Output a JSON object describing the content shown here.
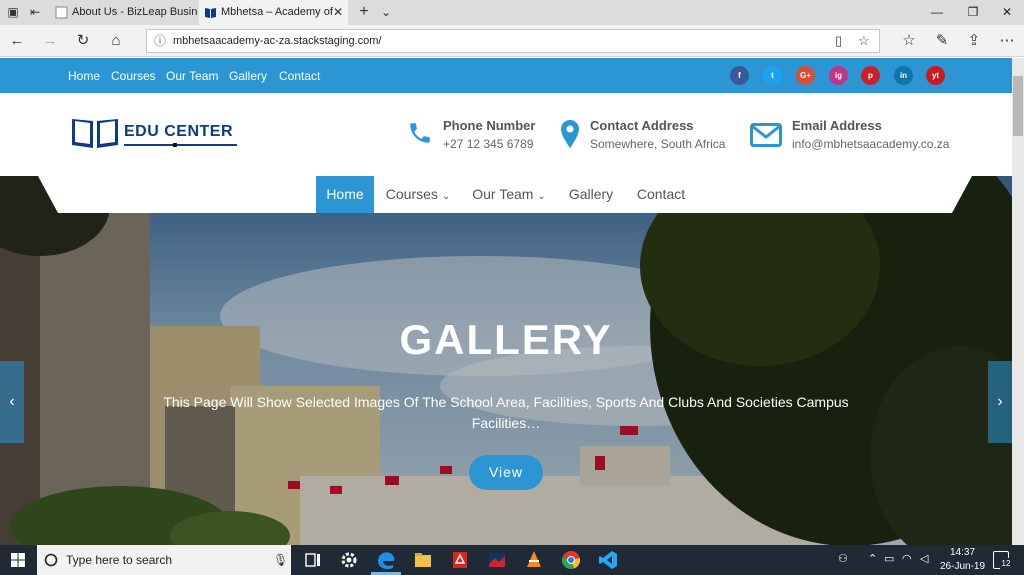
{
  "browser": {
    "tabs": [
      {
        "title": "About Us - BizLeap Business"
      },
      {
        "title": "Mbhetsa – Academy of"
      }
    ],
    "url": "mbhetsaacademy-ac-za.stackstaging.com/"
  },
  "topbar": {
    "links": [
      "Home",
      "Courses",
      "Our Team",
      "Gallery",
      "Contact"
    ],
    "social": [
      "f",
      "t",
      "G+",
      "ig",
      "p",
      "in",
      "yt"
    ]
  },
  "header": {
    "logo_text": "EDU CENTER",
    "phone": {
      "title": "Phone Number",
      "value": "+27 12 345 6789"
    },
    "address": {
      "title": "Contact Address",
      "value": "Somewhere, South Africa"
    },
    "email": {
      "title": "Email Address",
      "value": "info@mbhetsaacademy.co.za"
    }
  },
  "menu": {
    "home": "Home",
    "courses": "Courses",
    "team": "Our Team",
    "gallery": "Gallery",
    "contact": "Contact"
  },
  "hero": {
    "title": "GALLERY",
    "subtitle": "This Page Will Show Selected Images Of The School Area, Facilities, Sports And Clubs And Societies Campus Facilities…",
    "button": "View"
  },
  "taskbar": {
    "search_placeholder": "Type here to search",
    "time": "14:37",
    "date": "26-Jun-19",
    "notification_count": "12"
  },
  "colors": {
    "accent": "#2b96d3",
    "brand": "#0d3a8c"
  }
}
